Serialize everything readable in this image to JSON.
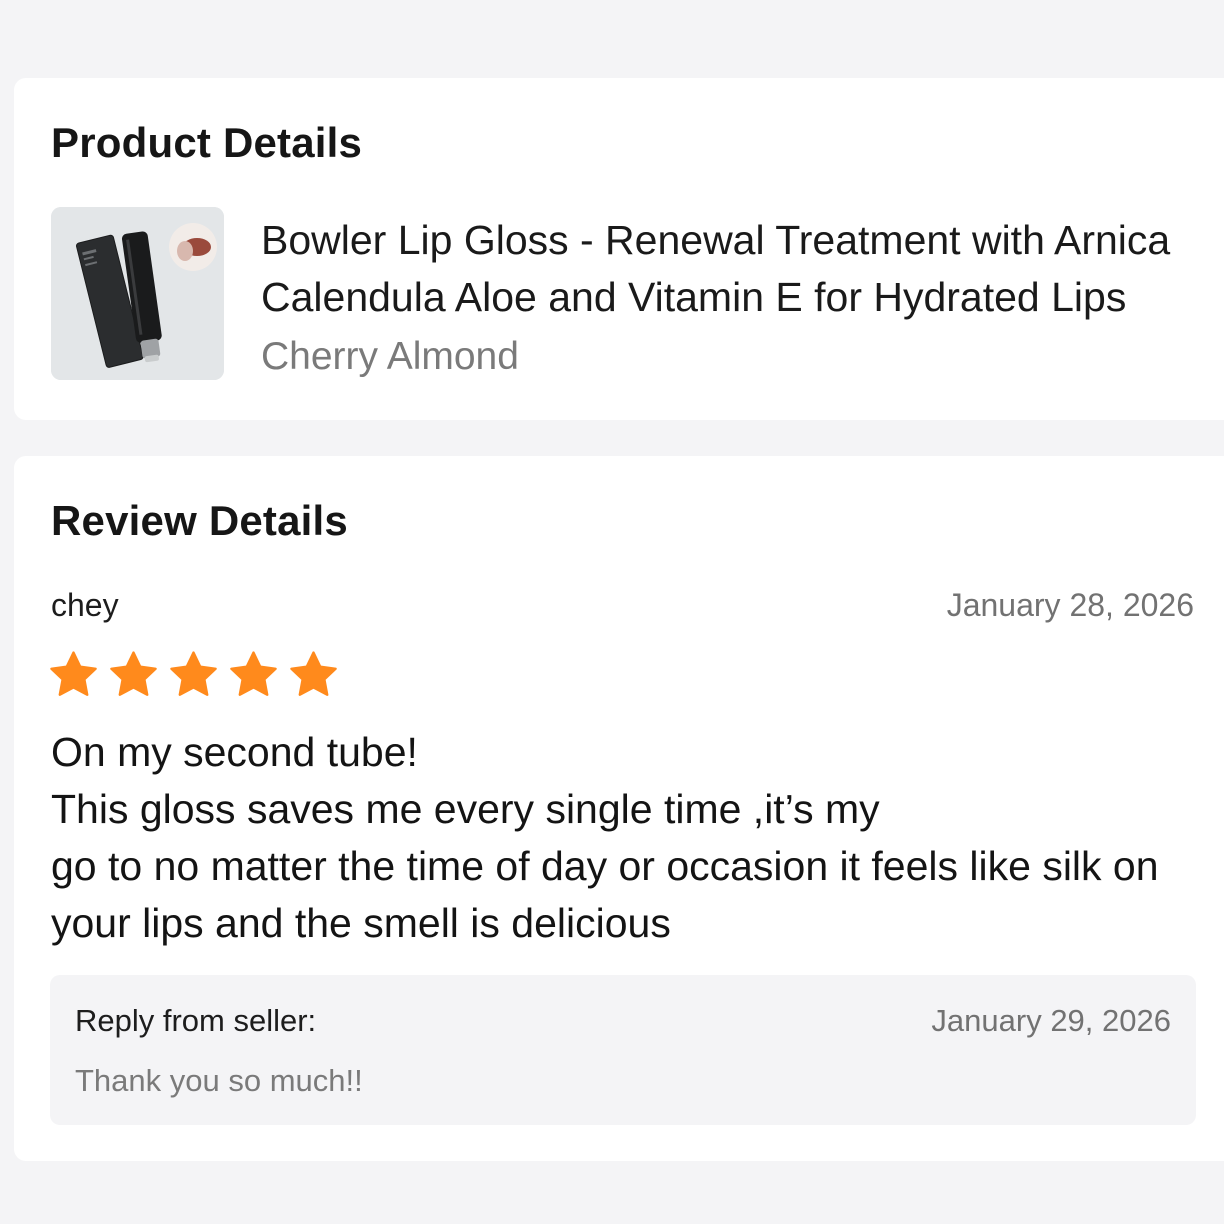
{
  "product_section": {
    "title": "Product Details",
    "product_name": "Bowler Lip Gloss - Renewal Treatment with Arnica Calendula Aloe and Vitamin E for Hydrated Lips",
    "variant": "Cherry Almond",
    "thumbnail_icon": "lip-gloss-product-image"
  },
  "review_section": {
    "title": "Review Details",
    "reviewer": "chey",
    "date": "January 28, 2026",
    "rating": 5,
    "rating_max": 5,
    "star_color": "#ff8a1c",
    "body": "On my second tube!\nThis gloss saves me every single time ,it’s my\ngo to no matter the time of day or occasion it feels like silk on your lips and the smell is delicious",
    "reply": {
      "label": "Reply from seller:",
      "date": "January 29, 2026",
      "text": "Thank you so much!!"
    }
  },
  "colors": {
    "background": "#f4f4f6",
    "card": "#ffffff",
    "muted_text": "#727272"
  }
}
